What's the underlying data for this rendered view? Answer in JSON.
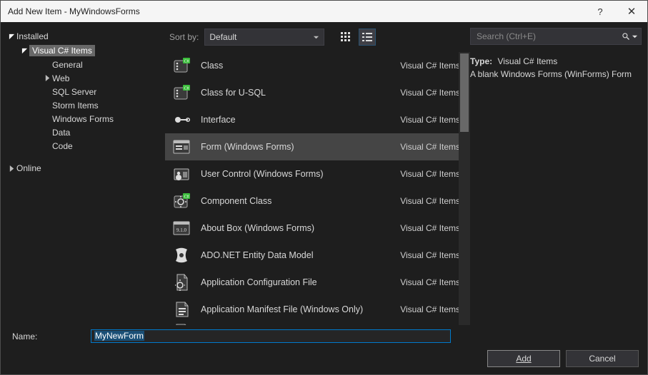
{
  "title": "Add New Item - MyWindowsForms",
  "titlebar": {
    "help": "?",
    "close": "✕"
  },
  "tree": {
    "installed": "Installed",
    "csitems": "Visual C# Items",
    "leaves": [
      "General",
      "Web",
      "SQL Server",
      "Storm Items",
      "Windows Forms",
      "Data",
      "Code"
    ],
    "web_has_children": true,
    "online": "Online"
  },
  "toolbar": {
    "sort_label": "Sort by:",
    "sort_value": "Default"
  },
  "lang": "Visual C# Items",
  "items": [
    {
      "name": "Class",
      "icon": "class"
    },
    {
      "name": "Class for U-SQL",
      "icon": "class"
    },
    {
      "name": "Interface",
      "icon": "interface"
    },
    {
      "name": "Form (Windows Forms)",
      "icon": "form",
      "selected": true
    },
    {
      "name": "User Control (Windows Forms)",
      "icon": "usercontrol"
    },
    {
      "name": "Component Class",
      "icon": "component"
    },
    {
      "name": "About Box (Windows Forms)",
      "icon": "about"
    },
    {
      "name": "ADO.NET Entity Data Model",
      "icon": "ado"
    },
    {
      "name": "Application Configuration File",
      "icon": "config"
    },
    {
      "name": "Application Manifest File (Windows Only)",
      "icon": "manifest"
    }
  ],
  "search": {
    "placeholder": "Search (Ctrl+E)"
  },
  "info": {
    "type_label": "Type:",
    "type_value": "Visual C# Items",
    "description": "A blank Windows Forms (WinForms) Form"
  },
  "name_row": {
    "label": "Name:",
    "value": "MyNewForm"
  },
  "buttons": {
    "add": "Add",
    "cancel": "Cancel"
  }
}
